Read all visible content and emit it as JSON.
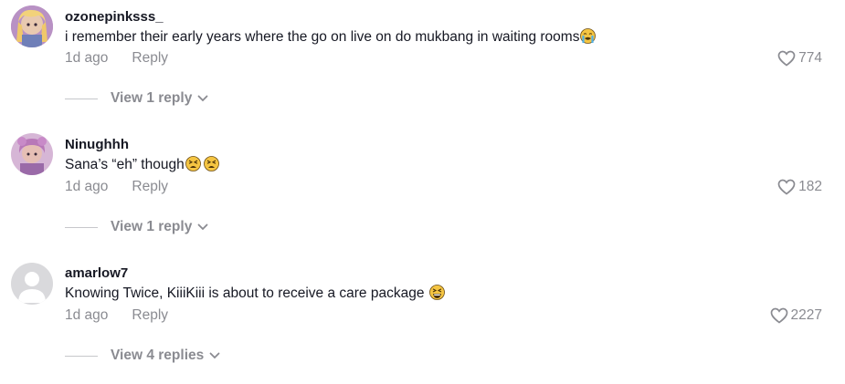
{
  "colors": {
    "username": "#161823",
    "meta": "#8a8b91",
    "divider": "#c6c7cb"
  },
  "comments": [
    {
      "username": "ozonepinksss_",
      "text": "i remember their early years where the go on live on do mukbang in waiting rooms",
      "emojis": [
        "crying-face-emoji"
      ],
      "time": "1d ago",
      "reply_label": "Reply",
      "likes": "774",
      "view_replies": "View 1 reply"
    },
    {
      "username": "Ninughhh",
      "text": "Sana’s “eh” though",
      "emojis": [
        "tired-face-emoji",
        "tired-face-emoji"
      ],
      "time": "1d ago",
      "reply_label": "Reply",
      "likes": "182",
      "view_replies": "View 1 reply"
    },
    {
      "username": "amarlow7",
      "text": "Knowing Twice, KiiiKiii is about to receive a care package",
      "emojis": [
        "grinning-squinting-face-emoji"
      ],
      "time": "1d ago",
      "reply_label": "Reply",
      "likes": "2227",
      "view_replies": "View 4 replies"
    }
  ]
}
